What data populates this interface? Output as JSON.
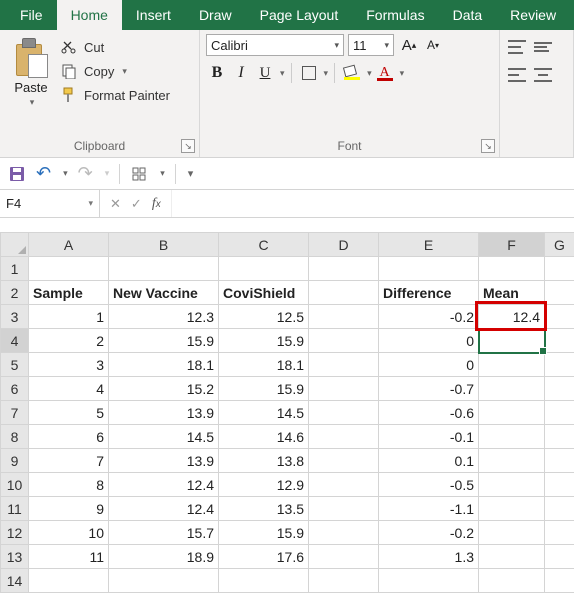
{
  "tabs": {
    "file": "File",
    "home": "Home",
    "insert": "Insert",
    "draw": "Draw",
    "pagelayout": "Page Layout",
    "formulas": "Formulas",
    "data": "Data",
    "review": "Review"
  },
  "clipboard": {
    "paste": "Paste",
    "cut": "Cut",
    "copy": "Copy",
    "formatpainter": "Format Painter",
    "group": "Clipboard"
  },
  "font": {
    "name": "Calibri",
    "size": "11",
    "group": "Font"
  },
  "namebox": "F4",
  "formula": "",
  "columns": [
    "A",
    "B",
    "C",
    "D",
    "E",
    "F",
    "G"
  ],
  "headers": {
    "A": "Sample",
    "B": "New Vaccine",
    "C": "CoviShield",
    "D": "",
    "E": "Difference",
    "F": "Mean",
    "G": ""
  },
  "rows": [
    {
      "n": "1"
    },
    {
      "n": "2",
      "header": true
    },
    {
      "n": "3",
      "A": "1",
      "B": "12.3",
      "C": "12.5",
      "E": "-0.2",
      "F": "12.4"
    },
    {
      "n": "4",
      "A": "2",
      "B": "15.9",
      "C": "15.9",
      "E": "0",
      "F": ""
    },
    {
      "n": "5",
      "A": "3",
      "B": "18.1",
      "C": "18.1",
      "E": "0",
      "F": ""
    },
    {
      "n": "6",
      "A": "4",
      "B": "15.2",
      "C": "15.9",
      "E": "-0.7",
      "F": ""
    },
    {
      "n": "7",
      "A": "5",
      "B": "13.9",
      "C": "14.5",
      "E": "-0.6",
      "F": ""
    },
    {
      "n": "8",
      "A": "6",
      "B": "14.5",
      "C": "14.6",
      "E": "-0.1",
      "F": ""
    },
    {
      "n": "9",
      "A": "7",
      "B": "13.9",
      "C": "13.8",
      "E": "0.1",
      "F": ""
    },
    {
      "n": "10",
      "A": "8",
      "B": "12.4",
      "C": "12.9",
      "E": "-0.5",
      "F": ""
    },
    {
      "n": "11",
      "A": "9",
      "B": "12.4",
      "C": "13.5",
      "E": "-1.1",
      "F": ""
    },
    {
      "n": "12",
      "A": "10",
      "B": "15.7",
      "C": "15.9",
      "E": "-0.2",
      "F": ""
    },
    {
      "n": "13",
      "A": "11",
      "B": "18.9",
      "C": "17.6",
      "E": "1.3",
      "F": ""
    },
    {
      "n": "14",
      "A": "",
      "B": "",
      "C": "",
      "E": "",
      "F": ""
    }
  ],
  "active_cell": "F4",
  "highlight_cell": "F3"
}
